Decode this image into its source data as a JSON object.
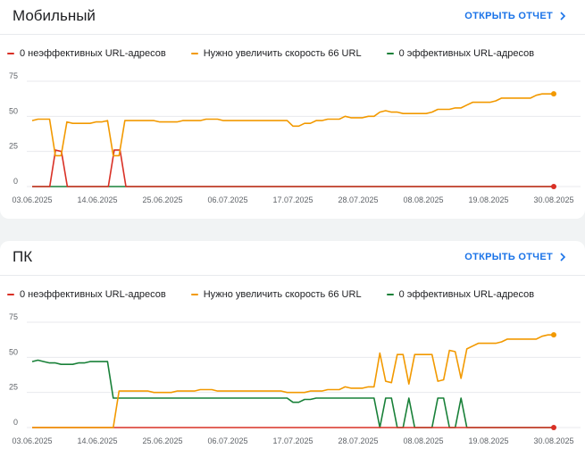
{
  "colors": {
    "red": "#d93025",
    "orange": "#f29900",
    "green": "#188038",
    "grid": "#e8eaed",
    "link": "#1a73e8"
  },
  "chart_data": [
    {
      "type": "line",
      "title": "Мобильный",
      "link_label": "ОТКРЫТЬ ОТЧЕТ",
      "ylim": [
        0,
        75
      ],
      "yticks": [
        "0",
        "25",
        "50",
        "75"
      ],
      "xticks": [
        "03.06.2025",
        "14.06.2025",
        "25.06.2025",
        "06.07.2025",
        "17.07.2025",
        "28.07.2025",
        "08.08.2025",
        "19.08.2025",
        "30.08.2025"
      ],
      "legend_position": "top-left",
      "grid": true,
      "series": [
        {
          "name": "0 неэффективных URL-адресов",
          "color": "red",
          "values": [
            0,
            0,
            0,
            0,
            26,
            25,
            0,
            0,
            0,
            0,
            0,
            0,
            0,
            0,
            26,
            26,
            0,
            0,
            0,
            0,
            0,
            0,
            0,
            0,
            0,
            0,
            0,
            0,
            0,
            0,
            0,
            0,
            0,
            0,
            0,
            0,
            0,
            0,
            0,
            0,
            0,
            0,
            0,
            0,
            0,
            0,
            0,
            0,
            0,
            0,
            0,
            0,
            0,
            0,
            0,
            0,
            0,
            0,
            0,
            0,
            0,
            0,
            0,
            0,
            0,
            0,
            0,
            0,
            0,
            0,
            0,
            0,
            0,
            0,
            0,
            0,
            0,
            0,
            0,
            0,
            0,
            0,
            0,
            0,
            0,
            0,
            0,
            0,
            0,
            0
          ]
        },
        {
          "name": "Нужно увеличить скорость 66 URL",
          "color": "orange",
          "values": [
            47,
            48,
            48,
            48,
            22,
            22,
            46,
            45,
            45,
            45,
            45,
            46,
            46,
            47,
            22,
            22,
            47,
            47,
            47,
            47,
            47,
            47,
            46,
            46,
            46,
            46,
            47,
            47,
            47,
            47,
            48,
            48,
            48,
            47,
            47,
            47,
            47,
            47,
            47,
            47,
            47,
            47,
            47,
            47,
            47,
            43,
            43,
            45,
            45,
            47,
            47,
            48,
            48,
            48,
            50,
            49,
            49,
            49,
            50,
            50,
            53,
            54,
            53,
            53,
            52,
            52,
            52,
            52,
            52,
            53,
            55,
            55,
            55,
            56,
            56,
            58,
            60,
            60,
            60,
            60,
            61,
            63,
            63,
            63,
            63,
            63,
            63,
            65,
            66,
            66,
            66
          ]
        },
        {
          "name": "0 эффективных URL-адресов",
          "color": "green",
          "values": [
            0,
            0,
            0,
            0,
            0,
            0,
            0,
            0,
            0,
            0,
            0,
            0,
            0,
            0,
            0,
            0,
            0,
            0,
            0,
            0,
            0,
            0,
            0,
            0,
            0,
            0,
            0,
            0,
            0,
            0,
            0,
            0,
            0,
            0,
            0,
            0,
            0,
            0,
            0,
            0,
            0,
            0,
            0,
            0,
            0,
            0,
            0,
            0,
            0,
            0,
            0,
            0,
            0,
            0,
            0,
            0,
            0,
            0,
            0,
            0,
            0,
            0,
            0,
            0,
            0,
            0,
            0,
            0,
            0,
            0,
            0,
            0,
            0,
            0,
            0,
            0,
            0,
            0,
            0,
            0,
            0,
            0,
            0,
            0,
            0,
            0,
            0,
            0,
            0,
            0,
            0
          ]
        }
      ]
    },
    {
      "type": "line",
      "title": "ПК",
      "link_label": "ОТКРЫТЬ ОТЧЕТ",
      "ylim": [
        0,
        75
      ],
      "yticks": [
        "0",
        "25",
        "50",
        "75"
      ],
      "xticks": [
        "03.06.2025",
        "14.06.2025",
        "25.06.2025",
        "06.07.2025",
        "17.07.2025",
        "28.07.2025",
        "08.08.2025",
        "19.08.2025",
        "30.08.2025"
      ],
      "legend_position": "top-left",
      "grid": true,
      "series": [
        {
          "name": "0 неэффективных URL-адресов",
          "color": "red",
          "values": [
            0,
            0,
            0,
            0,
            0,
            0,
            0,
            0,
            0,
            0,
            0,
            0,
            0,
            0,
            0,
            0,
            0,
            0,
            0,
            0,
            0,
            0,
            0,
            0,
            0,
            0,
            0,
            0,
            0,
            0,
            0,
            0,
            0,
            0,
            0,
            0,
            0,
            0,
            0,
            0,
            0,
            0,
            0,
            0,
            0,
            0,
            0,
            0,
            0,
            0,
            0,
            0,
            0,
            0,
            0,
            0,
            0,
            0,
            0,
            0,
            0,
            0,
            0,
            0,
            0,
            0,
            0,
            0,
            0,
            0,
            0,
            0,
            0,
            0,
            0,
            0,
            0,
            0,
            0,
            0,
            0,
            0,
            0,
            0,
            0,
            0,
            0,
            0,
            0,
            0,
            0
          ]
        },
        {
          "name": "Нужно увеличить скорость 66 URL",
          "color": "orange",
          "values": [
            0,
            0,
            0,
            0,
            0,
            0,
            0,
            0,
            0,
            0,
            0,
            0,
            0,
            0,
            0,
            26,
            26,
            26,
            26,
            26,
            26,
            25,
            25,
            25,
            25,
            26,
            26,
            26,
            26,
            27,
            27,
            27,
            26,
            26,
            26,
            26,
            26,
            26,
            26,
            26,
            26,
            26,
            26,
            26,
            25,
            25,
            25,
            25,
            26,
            26,
            26,
            27,
            27,
            27,
            29,
            28,
            28,
            28,
            29,
            29,
            53,
            33,
            32,
            52,
            52,
            31,
            52,
            52,
            52,
            52,
            33,
            34,
            55,
            54,
            35,
            56,
            58,
            60,
            60,
            60,
            60,
            61,
            63,
            63,
            63,
            63,
            63,
            63,
            65,
            66,
            66
          ]
        },
        {
          "name": "0 эффективных URL-адресов",
          "color": "green",
          "values": [
            47,
            48,
            47,
            46,
            46,
            45,
            45,
            45,
            46,
            46,
            47,
            47,
            47,
            47,
            21,
            21,
            21,
            21,
            21,
            21,
            21,
            21,
            21,
            21,
            21,
            21,
            21,
            21,
            21,
            21,
            21,
            21,
            21,
            21,
            21,
            21,
            21,
            21,
            21,
            21,
            21,
            21,
            21,
            21,
            21,
            18,
            18,
            20,
            20,
            21,
            21,
            21,
            21,
            21,
            21,
            21,
            21,
            21,
            21,
            21,
            0,
            21,
            21,
            0,
            0,
            21,
            0,
            0,
            0,
            0,
            21,
            21,
            0,
            0,
            21,
            0,
            0,
            0,
            0,
            0,
            0,
            0,
            0,
            0,
            0,
            0,
            0,
            0,
            0,
            0,
            0
          ]
        }
      ]
    }
  ]
}
